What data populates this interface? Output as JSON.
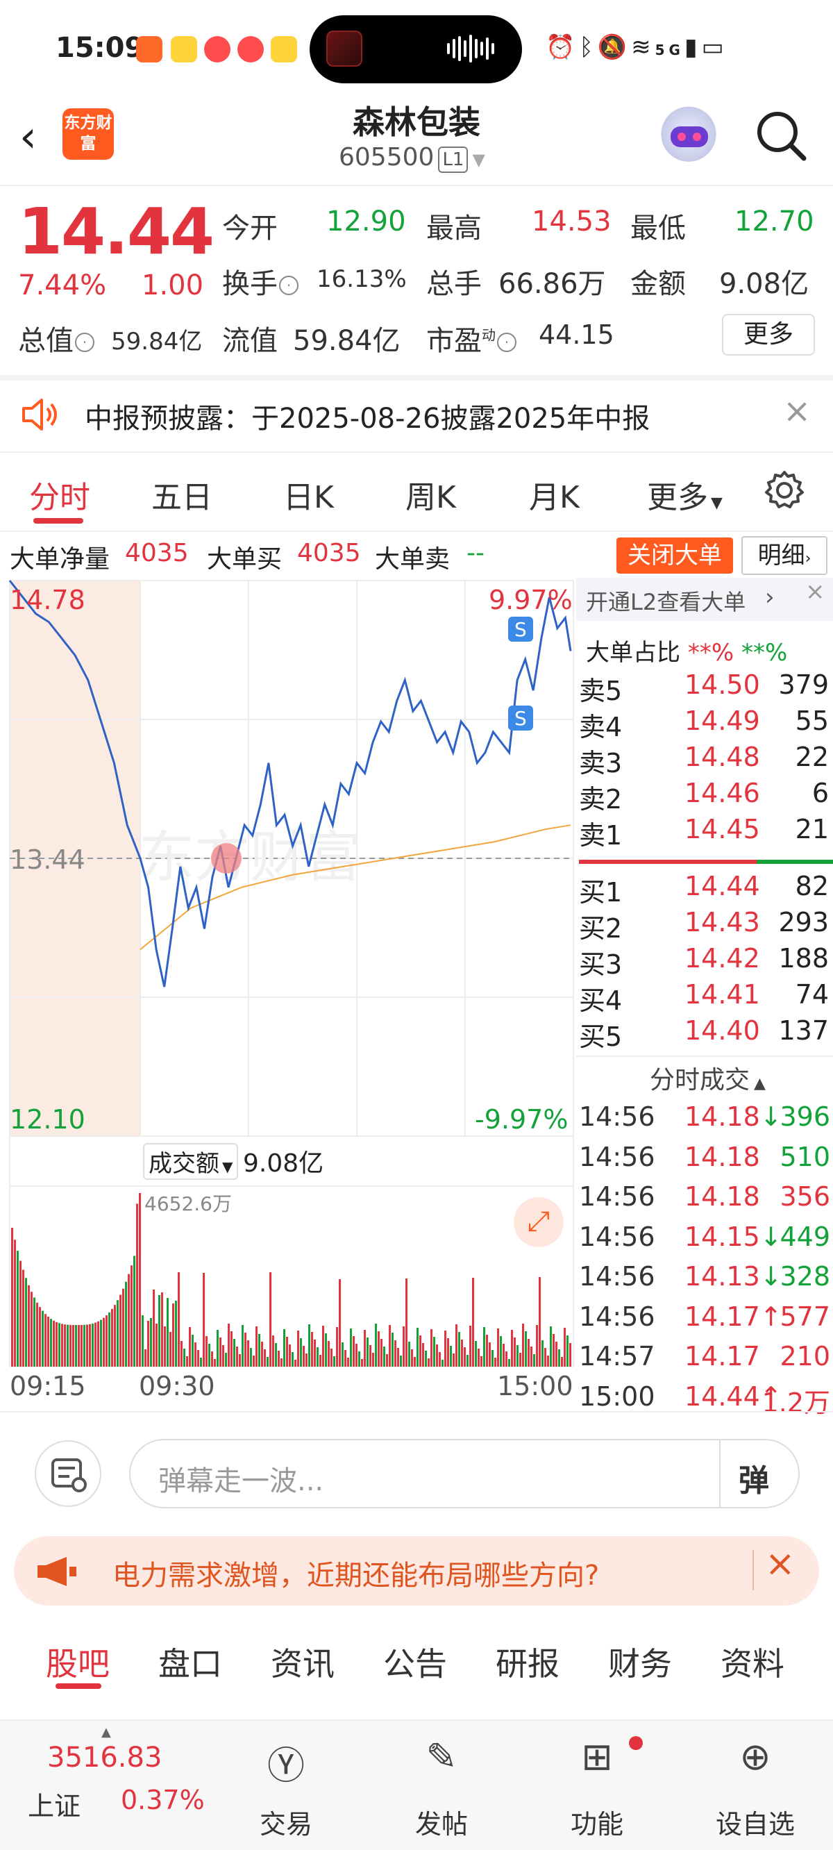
{
  "status_bar": {
    "time": "15:09",
    "network": "5G"
  },
  "header": {
    "title": "森林包装",
    "code": "605500",
    "level": "L1",
    "logo_text": "东方财富"
  },
  "quote": {
    "price": "14.44",
    "change_pct": "7.44%",
    "change": "1.00",
    "open_label": "今开",
    "open": "12.90",
    "high_label": "最高",
    "high": "14.53",
    "low_label": "最低",
    "low": "12.70",
    "turnover_label": "换手",
    "turnover": "16.13%",
    "volume_label": "总手",
    "volume": "66.86万",
    "amount_label": "金额",
    "amount": "9.08亿",
    "mktcap_label": "总值",
    "mktcap": "59.84亿",
    "float_label": "流值",
    "float": "59.84亿",
    "pe_label": "市盈",
    "pe_sup": "动",
    "pe": "44.15",
    "more": "更多"
  },
  "notice": {
    "text": "中报预披露：于2025-08-26披露2025年中报"
  },
  "chart_tabs": [
    "分时",
    "五日",
    "日K",
    "周K",
    "月K",
    "更多"
  ],
  "bigorder": {
    "net_label": "大单净量",
    "net": "4035",
    "buy_label": "大单买",
    "buy": "4035",
    "sell_label": "大单卖",
    "sell": "--",
    "close_btn": "关闭大单",
    "detail_btn": "明细"
  },
  "chart_data": {
    "type": "line",
    "price_top": "14.78",
    "price_mid": "13.44",
    "price_bottom": "12.10",
    "pct_top": "9.97%",
    "pct_bottom": "-9.97%",
    "volume_label": "成交额",
    "volume_total": "9.08亿",
    "volume_max": "4652.6万",
    "x_ticks": [
      "09:15",
      "09:30",
      "15:00"
    ],
    "ylim": [
      12.1,
      14.78
    ],
    "series": [
      {
        "name": "price",
        "values": [
          14.78,
          14.7,
          14.62,
          14.58,
          14.5,
          14.42,
          14.3,
          14.1,
          13.9,
          13.6,
          13.44,
          13.3,
          13.0,
          12.82,
          13.1,
          13.4,
          13.2,
          13.3,
          13.1,
          13.35,
          13.5,
          13.3,
          13.45,
          13.6,
          13.55,
          13.7,
          13.9,
          13.6,
          13.65,
          13.5,
          13.6,
          13.4,
          13.55,
          13.7,
          13.6,
          13.8,
          13.75,
          13.9,
          13.85,
          14.0,
          14.1,
          14.05,
          14.2,
          14.3,
          14.15,
          14.2,
          14.1,
          14.0,
          14.05,
          13.95,
          14.1,
          14.05,
          13.9,
          13.95,
          14.05,
          14.0,
          13.95,
          14.3,
          14.4,
          14.25,
          14.5,
          14.7,
          14.55,
          14.6,
          14.44
        ]
      },
      {
        "name": "avg",
        "values": [
          13.0,
          13.1,
          13.2,
          13.25,
          13.3,
          13.33,
          13.36,
          13.38,
          13.4,
          13.42,
          13.44,
          13.46,
          13.48,
          13.5,
          13.52,
          13.55,
          13.58,
          13.6
        ]
      }
    ]
  },
  "orderbook": {
    "l2_link": "开通L2查看大单",
    "ratio_label": "大单占比",
    "ratio_buy": "**%",
    "ratio_sell": "**%",
    "asks": [
      {
        "label": "卖5",
        "price": "14.50",
        "vol": "379"
      },
      {
        "label": "卖4",
        "price": "14.49",
        "vol": "55"
      },
      {
        "label": "卖3",
        "price": "14.48",
        "vol": "22"
      },
      {
        "label": "卖2",
        "price": "14.46",
        "vol": "6"
      },
      {
        "label": "卖1",
        "price": "14.45",
        "vol": "21"
      }
    ],
    "bids": [
      {
        "label": "买1",
        "price": "14.44",
        "vol": "82"
      },
      {
        "label": "买2",
        "price": "14.43",
        "vol": "293"
      },
      {
        "label": "买3",
        "price": "14.42",
        "vol": "188"
      },
      {
        "label": "买4",
        "price": "14.41",
        "vol": "74"
      },
      {
        "label": "买5",
        "price": "14.40",
        "vol": "137"
      }
    ],
    "ticks_label": "分时成交",
    "ticks": [
      {
        "time": "14:56",
        "price": "14.18",
        "arrow": "↓",
        "vol": "396",
        "dir": "down",
        "vcolor": "green"
      },
      {
        "time": "14:56",
        "price": "14.18",
        "arrow": "",
        "vol": "510",
        "dir": "flat",
        "vcolor": "green"
      },
      {
        "time": "14:56",
        "price": "14.18",
        "arrow": "",
        "vol": "356",
        "dir": "flat",
        "vcolor": "red"
      },
      {
        "time": "14:56",
        "price": "14.15",
        "arrow": "↓",
        "vol": "449",
        "dir": "down",
        "vcolor": "green"
      },
      {
        "time": "14:56",
        "price": "14.13",
        "arrow": "↓",
        "vol": "328",
        "dir": "down",
        "vcolor": "green"
      },
      {
        "time": "14:56",
        "price": "14.17",
        "arrow": "↑",
        "vol": "577",
        "dir": "up",
        "vcolor": "red"
      },
      {
        "time": "14:57",
        "price": "14.17",
        "arrow": "",
        "vol": "210",
        "dir": "flat",
        "vcolor": "red"
      },
      {
        "time": "15:00",
        "price": "14.44",
        "arrow": "↑",
        "vol": "1.2万",
        "dir": "up",
        "vcolor": "red"
      }
    ]
  },
  "barrage": {
    "placeholder": "弹幕走一波...",
    "btn": "弹"
  },
  "ad": {
    "text": "电力需求激增，近期还能布局哪些方向?"
  },
  "bottom_tabs": [
    "股吧",
    "盘口",
    "资讯",
    "公告",
    "研报",
    "财务",
    "资料"
  ],
  "nav": {
    "index_value": "3516.83",
    "index_name": "上证",
    "index_pct": "0.37%",
    "items": [
      "交易",
      "发帖",
      "功能",
      "设自选"
    ]
  }
}
